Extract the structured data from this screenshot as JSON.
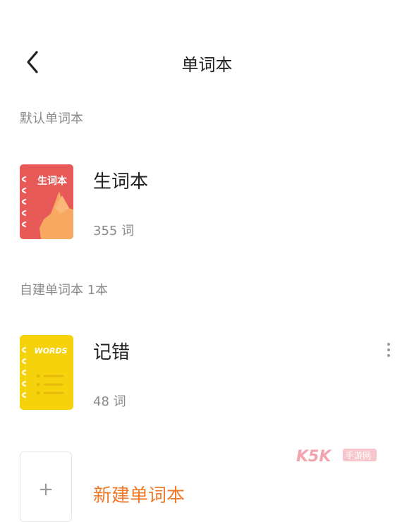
{
  "header": {
    "title": "单词本"
  },
  "sections": [
    {
      "label": "默认单词本"
    },
    {
      "label": "自建单词本  1本"
    }
  ],
  "books": [
    {
      "name": "生词本",
      "count": "355 词",
      "cover_text": "生词本",
      "cover_color": "#e85a57"
    },
    {
      "name": "记错",
      "count": "48 词",
      "cover_text": "WORDS",
      "cover_color": "#f5d20c"
    }
  ],
  "add": {
    "plus": "+",
    "label": "新建单词本",
    "color": "#f07a2a"
  },
  "watermark": {
    "text": "K5K手游网"
  }
}
